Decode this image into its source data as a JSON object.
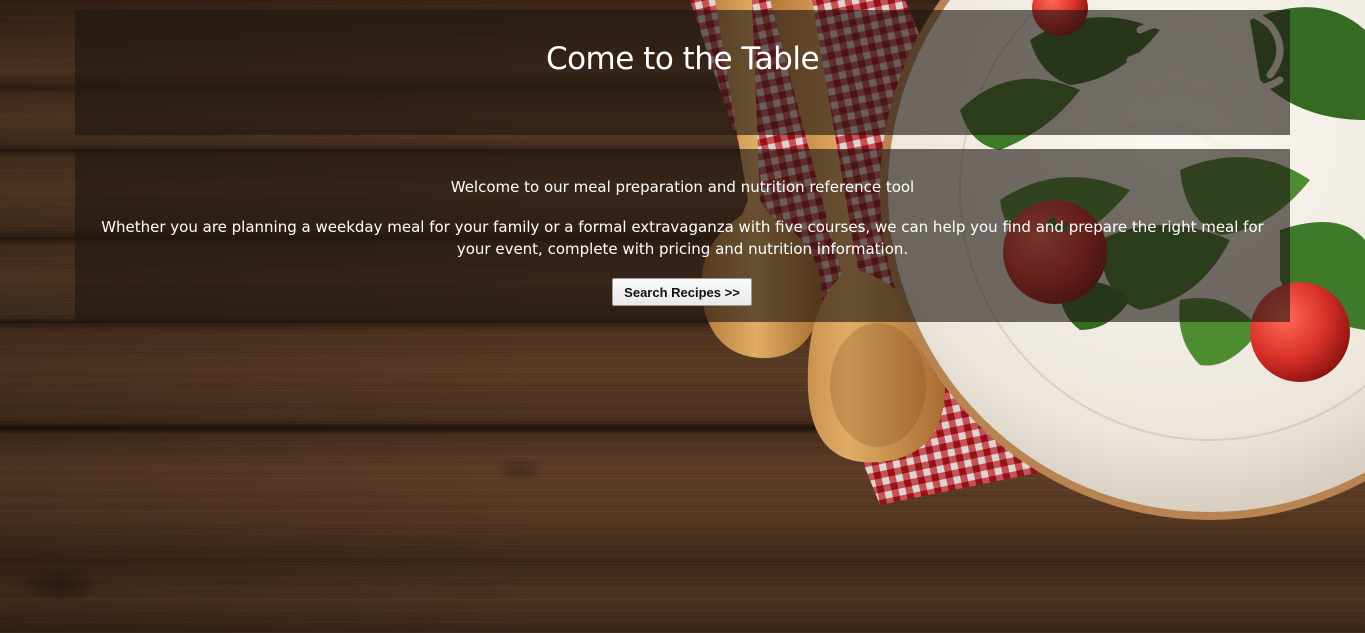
{
  "header": {
    "title": "Come to the Table"
  },
  "intro": {
    "welcome": "Welcome to our meal preparation and nutrition reference tool",
    "description": "Whether you are planning a weekday meal for your family or a formal extravaganza with five courses, we can help you find and prepare the right meal for your event, complete with pricing and nutrition information."
  },
  "actions": {
    "search_label": "Search Recipes >>"
  },
  "background": {
    "subject": "salad plate with wooden spoons on red checkered napkin over wooden table",
    "colors": {
      "wood": "#4a2f1d",
      "napkin_red": "#c8202c",
      "spoon": "#d9a35a",
      "plate": "#f1ede6",
      "greens": "#3f7a2a",
      "tomato": "#d8302a"
    }
  }
}
